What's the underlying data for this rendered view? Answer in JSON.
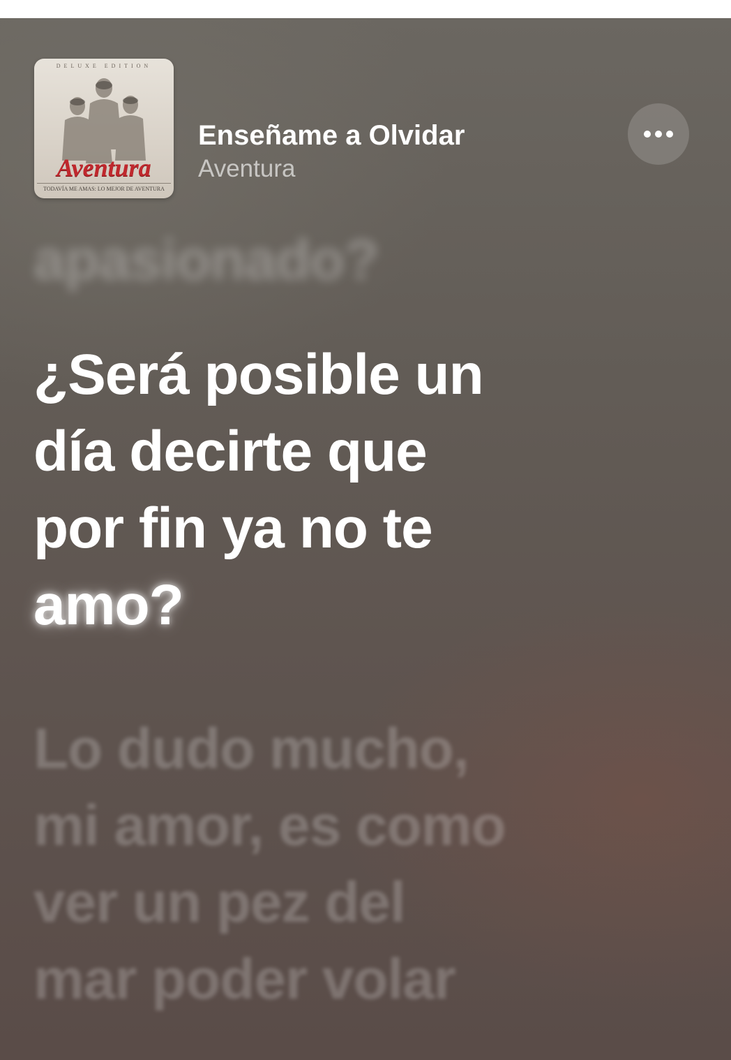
{
  "now_playing": {
    "title": "Enseñame a Olvidar",
    "artist": "Aventura",
    "more_icon": "ellipsis-icon"
  },
  "artwork": {
    "edition_label": "DELUXE EDITION",
    "brand": "Aventura",
    "subtitle": "TODAVÍA ME AMAS: LO MEJOR DE AVENTURA",
    "brand_color": "#c0282d"
  },
  "lyrics": {
    "previous": "apasionado?",
    "current_lines": [
      "¿Será posible un",
      "día decirte que",
      "por fin ya no te",
      "amo?"
    ],
    "next_lines": [
      "Lo dudo mucho,",
      "mi amor, es como",
      "ver un pez del",
      "mar poder volar"
    ]
  }
}
